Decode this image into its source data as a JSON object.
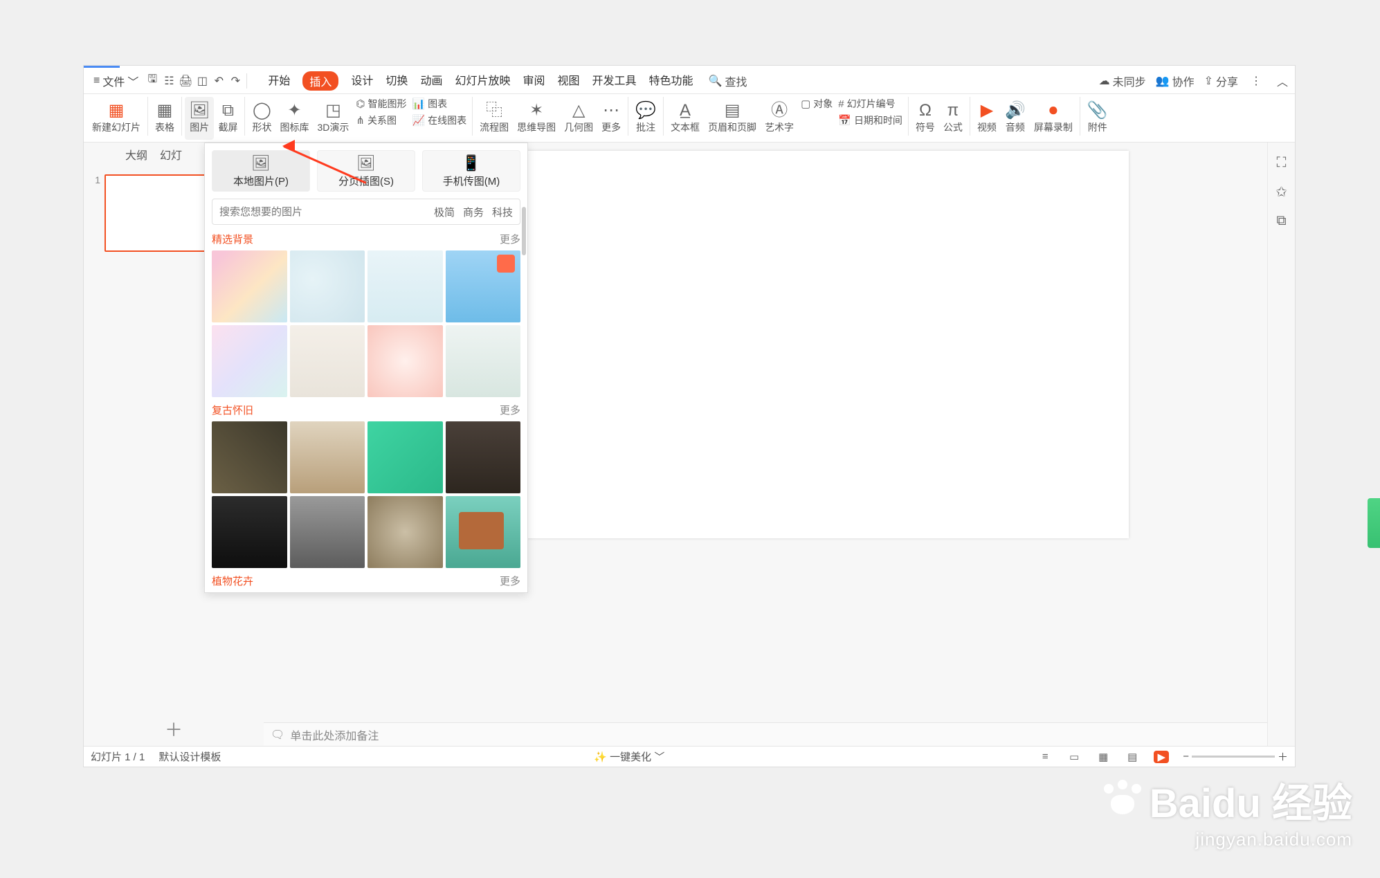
{
  "quick": {
    "file_label": "文件",
    "menu_icon": "≡"
  },
  "menu": {
    "tabs": [
      "开始",
      "插入",
      "设计",
      "切换",
      "动画",
      "幻灯片放映",
      "审阅",
      "视图",
      "开发工具",
      "特色功能"
    ],
    "active_index": 1,
    "search_label": "查找"
  },
  "top_right": {
    "unsync": "未同步",
    "collab": "协作",
    "share": "分享"
  },
  "ribbon": {
    "new_slide": "新建幻灯片",
    "table": "表格",
    "picture": "图片",
    "screenshot": "截屏",
    "shape": "形状",
    "icon_lib": "图标库",
    "three_d": "3D演示",
    "smart_art": "智能图形",
    "relation": "关系图",
    "chart": "图表",
    "online_chart": "在线图表",
    "flow": "流程图",
    "mindmap": "思维导图",
    "geometry": "几何图",
    "more": "更多",
    "comment": "批注",
    "textbox": "文本框",
    "header_footer": "页眉和页脚",
    "wordart": "艺术字",
    "object": "对象",
    "slide_num": "幻灯片编号",
    "date_time": "日期和时间",
    "symbol": "符号",
    "formula": "公式",
    "video": "视频",
    "audio": "音频",
    "screen_rec": "屏幕录制",
    "attachment": "附件"
  },
  "side": {
    "outline": "大纲",
    "slides": "幻灯",
    "thumb_num": "1"
  },
  "dropdown": {
    "local_image": "本地图片(P)",
    "page_illus": "分页插图(S)",
    "phone_img": "手机传图(M)",
    "search_placeholder": "搜索您想要的图片",
    "tags": [
      "极简",
      "商务",
      "科技"
    ],
    "sec1_title": "精选背景",
    "sec2_title": "复古怀旧",
    "sec3_title": "植物花卉",
    "more": "更多"
  },
  "notes": {
    "placeholder": "单击此处添加备注"
  },
  "status": {
    "slide_pos": "幻灯片 1 / 1",
    "template": "默认设计模板",
    "beautify": "一键美化"
  },
  "watermark": {
    "brand": "Baidu 经验",
    "url": "jingyan.baidu.com"
  }
}
